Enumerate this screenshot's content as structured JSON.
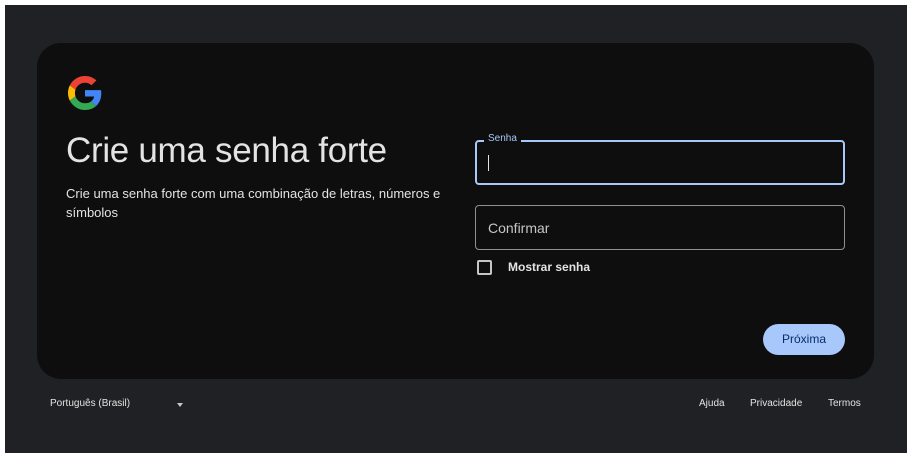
{
  "header": {
    "logo": "google-logo",
    "title": "Crie uma senha forte",
    "subtitle": "Crie uma senha forte com uma combinação de letras, números e símbolos"
  },
  "form": {
    "password": {
      "label": "Senha",
      "value": ""
    },
    "confirm": {
      "placeholder": "Confirmar",
      "value": ""
    },
    "show_password": {
      "label": "Mostrar senha",
      "checked": false
    },
    "next_label": "Próxima"
  },
  "footer": {
    "language": "Português (Brasil)",
    "links": [
      "Ajuda",
      "Privacidade",
      "Termos"
    ]
  },
  "colors": {
    "page_background": "#202124",
    "card_background": "#0e0e0e",
    "accent": "#a8c7fa",
    "button_text": "#062e6f"
  }
}
